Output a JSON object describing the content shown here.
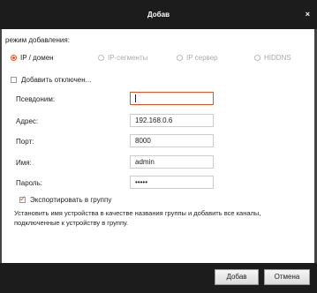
{
  "dialog": {
    "title": "Добав",
    "close_glyph": "×"
  },
  "mode": {
    "label": "режим добавления:",
    "options": [
      {
        "label": "IP / домен",
        "checked": true,
        "enabled": true
      },
      {
        "label": "IP-сегменты",
        "checked": false,
        "enabled": false
      },
      {
        "label": "IP сервер",
        "checked": false,
        "enabled": false
      },
      {
        "label": "HIDDNS",
        "checked": false,
        "enabled": false
      }
    ]
  },
  "add_offline": {
    "label": "Добавить отключен...",
    "checked": false
  },
  "form": {
    "alias_label": "Псевдоним:",
    "alias_value": "",
    "address_label": "Адрес:",
    "address_value": "192.168.0.6",
    "port_label": "Порт:",
    "port_value": "8000",
    "user_label": "Имя:",
    "user_value": "admin",
    "password_label": "Пароль:",
    "password_value": "•••••"
  },
  "export_group": {
    "label": "Экспортировать в группу",
    "checked": true
  },
  "info_text": "Установить имя устройства в качестве названия группы и добавить все каналы, подключенные к устройству в группу.",
  "buttons": {
    "add": "Добав",
    "cancel": "Отмена"
  },
  "colors": {
    "accent": "#d7582a",
    "titlebar": "#1c1c1c"
  }
}
